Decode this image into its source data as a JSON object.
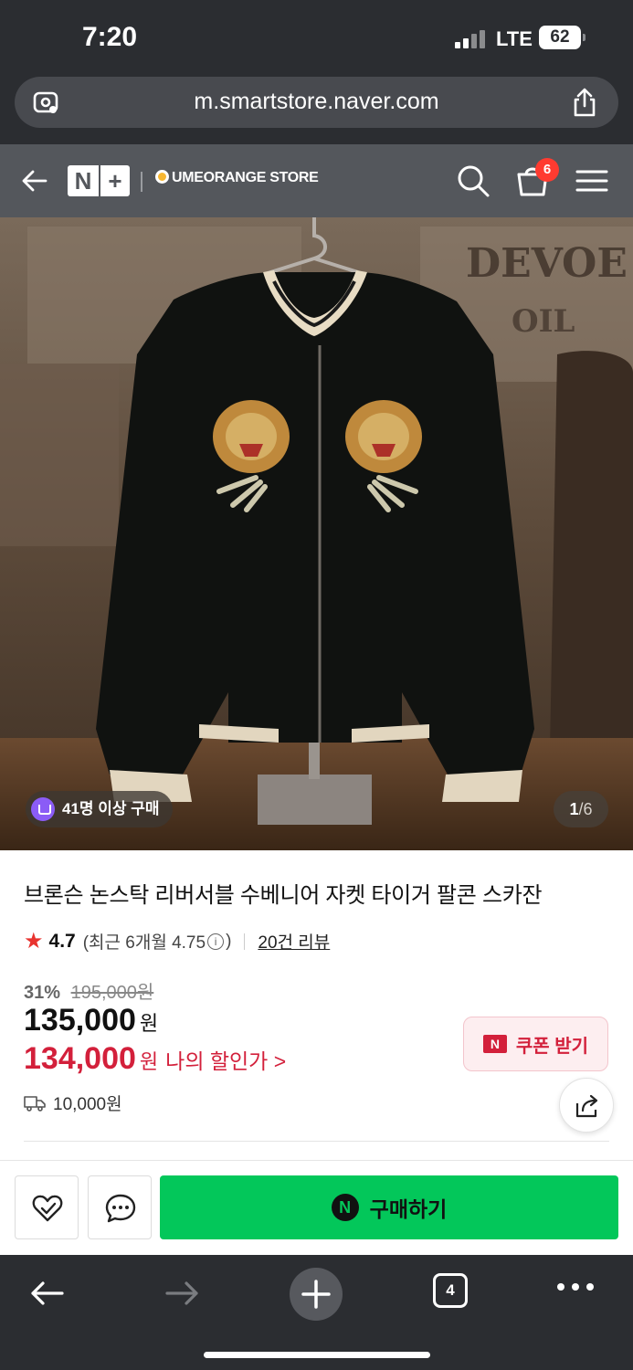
{
  "status_bar": {
    "time": "7:20",
    "network": "LTE",
    "battery": "62"
  },
  "browser": {
    "url": "m.smartstore.naver.com",
    "open_tabs": "4"
  },
  "store_header": {
    "nplus_n": "N",
    "nplus_plus": "+",
    "store_name": "UMEORANGE STORE",
    "cart_count": "6"
  },
  "hero": {
    "purchase_badge": "41명 이상 구매",
    "pager_current": "1",
    "pager_sep": "/",
    "pager_total": "6"
  },
  "product": {
    "title": "브론슨 논스탁 리버서블 수베니어 자켓 타이거 팔콘 스카잔",
    "rating": "4.7",
    "recent_rating_prefix": "(최근 6개월 4.75",
    "recent_rating_suffix": ")",
    "info_glyph": "i",
    "review_count": "20건 리뷰",
    "discount_percent": "31%",
    "original_price": "195,000원",
    "price": "135,000",
    "price_unit": "원",
    "my_price": "134,000",
    "my_price_unit": "원",
    "my_price_label": "나의 할인가 >",
    "shipping_fee": "10,000원"
  },
  "coupon": {
    "n_badge": "N",
    "label": "쿠폰 받기"
  },
  "buy_bar": {
    "n_logo": "N",
    "buy_label": "구매하기"
  },
  "colors": {
    "naver_green": "#03c75a",
    "sale_red": "#d3203b",
    "header_gray": "#54575c",
    "browser_dark": "#2b2d31"
  },
  "icons": [
    "back-arrow-icon",
    "search-icon",
    "cart-icon",
    "menu-icon",
    "share-icon",
    "heart-icon",
    "chat-icon",
    "truck-icon",
    "star-icon",
    "page-share-icon",
    "site-settings-icon",
    "forward-arrow-icon",
    "plus-icon",
    "more-icon"
  ]
}
